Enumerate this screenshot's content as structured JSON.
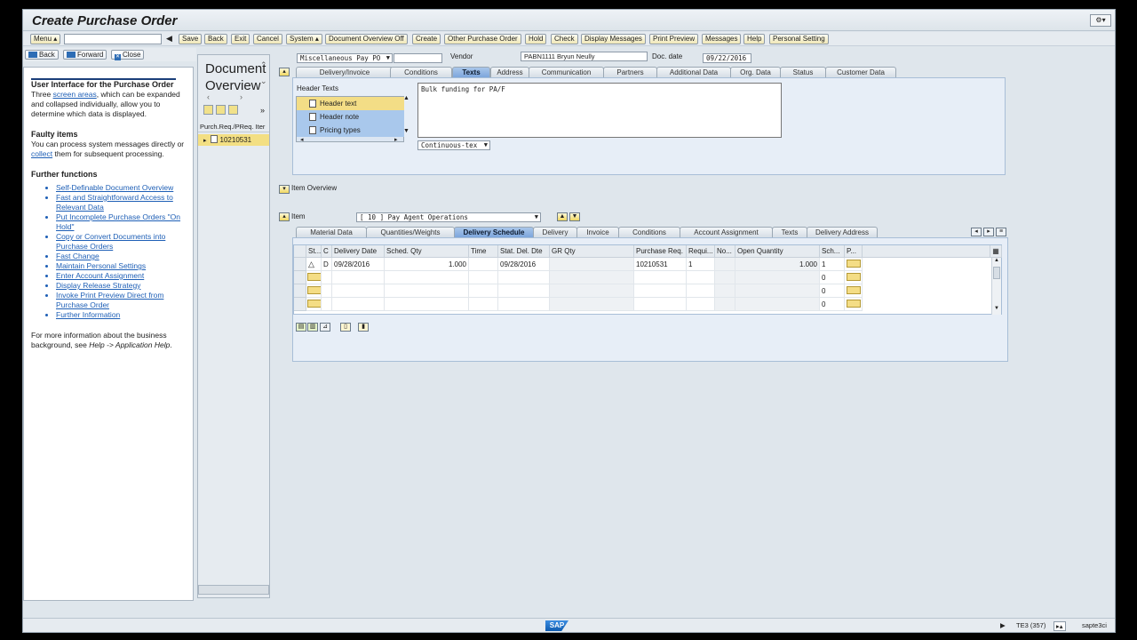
{
  "app": {
    "title": "Create Purchase Order"
  },
  "toolbar": {
    "menu": "Menu ▴",
    "save": "Save",
    "back": "Back",
    "exit": "Exit",
    "cancel": "Cancel",
    "system": "System ▴",
    "doc_overview_off": "Document Overview Off",
    "create": "Create",
    "other_po": "Other Purchase Order",
    "hold": "Hold",
    "check": "Check",
    "display_messages": "Display Messages",
    "print_preview": "Print Preview",
    "messages": "Messages",
    "help": "Help",
    "personal_setting": "Personal Setting"
  },
  "help_nav": {
    "back": "Back",
    "forward": "Forward",
    "close": "Close"
  },
  "help_panel": {
    "heading1": "User Interface for the Purchase Order",
    "p1_pre": "Three ",
    "p1_link": "screen areas",
    "p1_post": ", which can be expanded and collapsed individually, allow you to determine which data is displayed.",
    "heading2": "Faulty items",
    "p2_pre": "You can process system messages directly or ",
    "p2_link": "collect",
    "p2_post": " them for subsequent processing.",
    "heading3": "Further functions",
    "links": [
      "Self-Definable Document Overview",
      "Fast and Straightforward Access to Relevant Data",
      "Put Incomplete Purchase Orders \"On Hold\"",
      "Copy or Convert Documents into Purchase Orders",
      "Fast Change",
      "Maintain Personal Settings",
      "Enter Account Assignment",
      "Display Release Strategy",
      "Invoke Print Preview Direct from Purchase Order",
      "Further Information"
    ],
    "footer_pre": "For more information about the business background, see ",
    "footer_it": "Help -> Application Help",
    "footer_post": "."
  },
  "doc_overview": {
    "title": "Document Overview",
    "column": "Purch.Req./PReq. Iter",
    "row": "10210531"
  },
  "header": {
    "po_type": "Miscellaneous Pay PO",
    "vendor_label": "Vendor",
    "vendor": "PABN1111 Bryun Neully",
    "doc_date_label": "Doc. date",
    "doc_date": "09/22/2016",
    "tabs": [
      "Delivery/Invoice",
      "Conditions",
      "Texts",
      "Address",
      "Communication",
      "Partners",
      "Additional Data",
      "Org. Data",
      "Status",
      "Customer Data"
    ],
    "active_tab": "Texts"
  },
  "header_texts": {
    "label": "Header Texts",
    "items": [
      "Header text",
      "Header note",
      "Pricing types"
    ],
    "text_value": "Bulk funding for PA/F",
    "format": "Continuous-tex"
  },
  "item_overview": {
    "label": "Item Overview"
  },
  "item": {
    "label": "Item",
    "selected": "[ 10 ] Pay Agent Operations",
    "tabs": [
      "Material Data",
      "Quantities/Weights",
      "Delivery Schedule",
      "Delivery",
      "Invoice",
      "Conditions",
      "Account Assignment",
      "Texts",
      "Delivery Address"
    ],
    "active_tab": "Delivery Schedule"
  },
  "schedule_table": {
    "columns": [
      "St...",
      "C",
      "Delivery Date",
      "Sched. Qty",
      "Time",
      "Stat. Del. Dte",
      "GR Qty",
      "Purchase Req.",
      "Requi...",
      "No...",
      "Open Quantity",
      "Sch...",
      "P..."
    ],
    "rows": [
      {
        "c": "D",
        "delivery_date": "09/28/2016",
        "sched_qty": "1.000",
        "stat_del_dte": "09/28/2016",
        "purchase_req": "10210531",
        "requi": "1",
        "open_qty": "1.000",
        "sch": "1"
      },
      {
        "c": "",
        "delivery_date": "",
        "sched_qty": "",
        "stat_del_dte": "",
        "purchase_req": "",
        "requi": "",
        "open_qty": "",
        "sch": "0"
      },
      {
        "c": "",
        "delivery_date": "",
        "sched_qty": "",
        "stat_del_dte": "",
        "purchase_req": "",
        "requi": "",
        "open_qty": "",
        "sch": "0"
      },
      {
        "c": "",
        "delivery_date": "",
        "sched_qty": "",
        "stat_del_dte": "",
        "purchase_req": "",
        "requi": "",
        "open_qty": "",
        "sch": "0"
      }
    ]
  },
  "status_bar": {
    "logo": "SAP",
    "system": "TE3 (357)",
    "server": "sapte3ci"
  }
}
